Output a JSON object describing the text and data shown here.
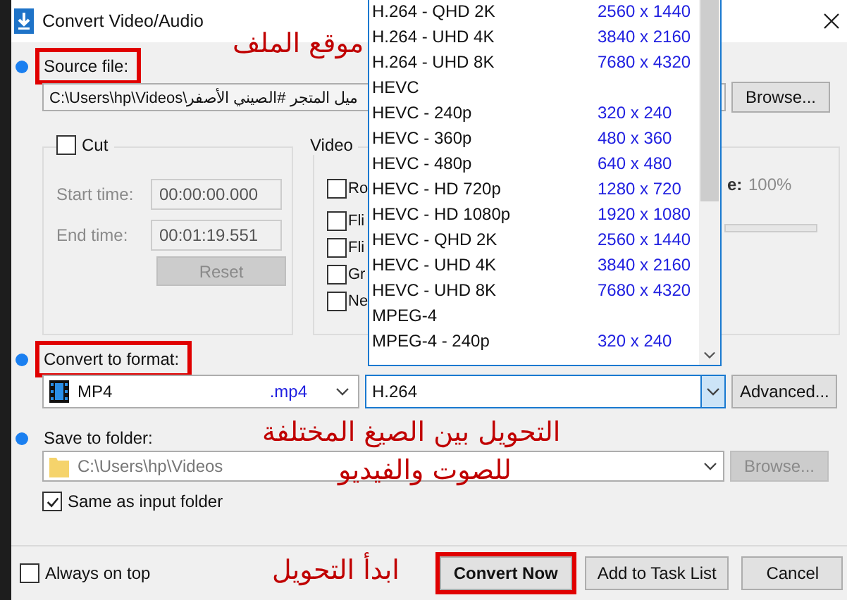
{
  "window": {
    "title": "Convert Video/Audio"
  },
  "source": {
    "label": "Source file:",
    "highlighted": true,
    "path": "C:\\Users\\hp\\Videos\\ميل المتجر #الصيني الأصفر",
    "browse": "Browse..."
  },
  "cut": {
    "label": "Cut",
    "checked": false,
    "fields": [
      {
        "label": "Start time:",
        "value": "00:00:00.000"
      },
      {
        "label": "End time:",
        "value": "00:01:19.551"
      }
    ],
    "reset": "Reset"
  },
  "video": {
    "label": "Video",
    "options": [
      {
        "label": "Ro",
        "checked": false
      },
      {
        "label": "Fli",
        "checked": false
      },
      {
        "label": "Fli",
        "checked": false
      },
      {
        "label": "Gr",
        "checked": false
      },
      {
        "label": "Ne",
        "checked": false
      }
    ],
    "setting_label": "e:",
    "setting_value": "100%"
  },
  "format": {
    "label": "Convert to format:",
    "highlighted": true,
    "container": "MP4",
    "extension": ".mp4",
    "codec": "H.264",
    "advanced": "Advanced..."
  },
  "codec_list": [
    {
      "name": "H.264 - QHD 2K",
      "resolution": "2560 x 1440"
    },
    {
      "name": "H.264 - UHD 4K",
      "resolution": "3840 x 2160"
    },
    {
      "name": "H.264 - UHD 8K",
      "resolution": "7680 x 4320"
    },
    {
      "name": "HEVC"
    },
    {
      "name": "HEVC - 240p",
      "resolution": "320 x 240"
    },
    {
      "name": "HEVC - 360p",
      "resolution": "480 x 360"
    },
    {
      "name": "HEVC - 480p",
      "resolution": "640 x 480"
    },
    {
      "name": "HEVC - HD 720p",
      "resolution": "1280 x 720"
    },
    {
      "name": "HEVC - HD 1080p",
      "resolution": "1920 x 1080"
    },
    {
      "name": "HEVC - QHD 2K",
      "resolution": "2560 x 1440"
    },
    {
      "name": "HEVC - UHD 4K",
      "resolution": "3840 x 2160"
    },
    {
      "name": "HEVC - UHD 8K",
      "resolution": "7680 x 4320"
    },
    {
      "name": "MPEG-4"
    },
    {
      "name": "MPEG-4 - 240p",
      "resolution": "320 x 240"
    }
  ],
  "save": {
    "label": "Save to folder:",
    "highlighted": false,
    "path": "C:\\Users\\hp\\Videos",
    "browse": "Browse...",
    "same_as_input": {
      "label": "Same as input folder",
      "checked": true
    }
  },
  "footer": {
    "always_on_top": {
      "label": "Always on top",
      "checked": false
    },
    "buttons": [
      {
        "label": "Convert Now",
        "kind": "primary",
        "highlighted": true
      },
      {
        "label": "Add to Task List",
        "kind": "normal",
        "highlighted": false
      },
      {
        "label": "Cancel",
        "kind": "normal",
        "highlighted": false
      }
    ]
  },
  "annotations": [
    {
      "text": "موقع الملف",
      "kind": "source"
    },
    {
      "text": "التحويل  بين الصيغ المختلفة",
      "kind": "format"
    },
    {
      "text": "للصوت والفيديو",
      "kind": "format2"
    },
    {
      "text": "ابدأ التحويل",
      "kind": "start"
    }
  ]
}
